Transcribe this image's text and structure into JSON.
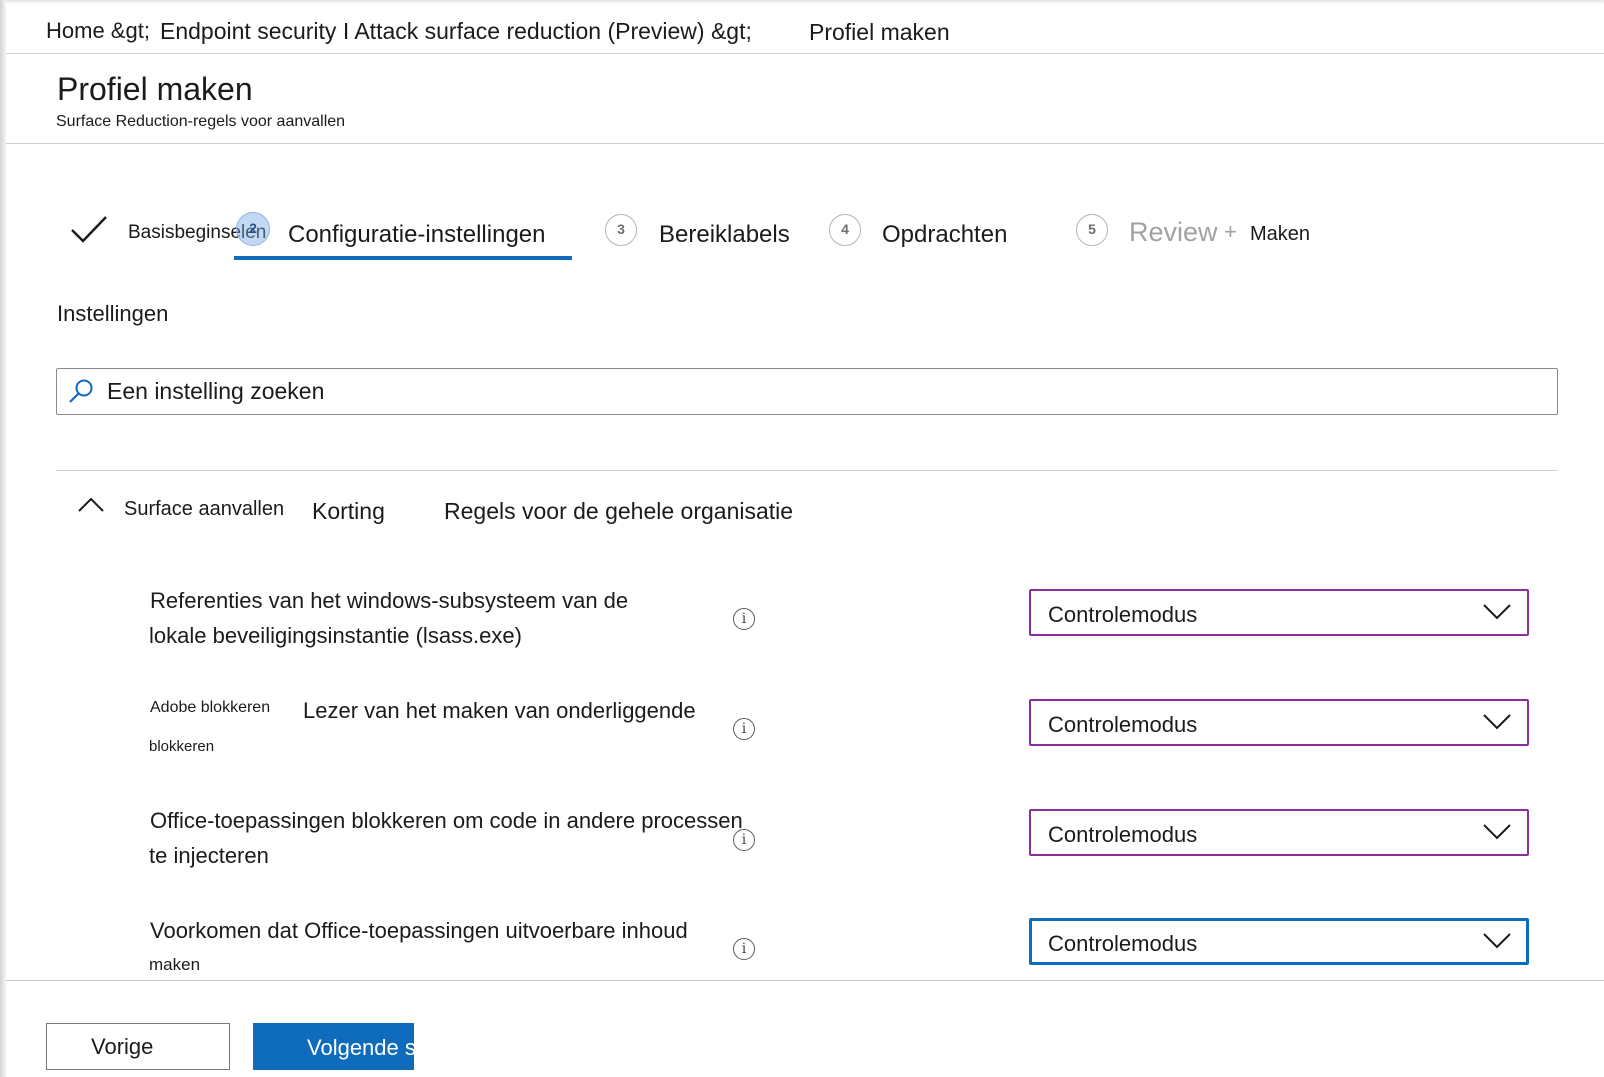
{
  "breadcrumb": {
    "home": "Home &gt;",
    "section": "Endpoint security I Attack surface reduction (Preview) &gt;",
    "current": "Profiel maken"
  },
  "header": {
    "title": "Profiel maken",
    "subtitle": "Surface Reduction-regels voor aanvallen"
  },
  "steps": {
    "step1": {
      "label": "Basisbeginselen"
    },
    "step2": {
      "number": "2",
      "label": "Configuratie-instellingen"
    },
    "step3": {
      "number": "3",
      "label": "Bereiklabels"
    },
    "step4": {
      "number": "4",
      "label": "Opdrachten"
    },
    "step5": {
      "number": "5",
      "label_a": "Review",
      "label_plus": "+",
      "label_b": "Maken"
    }
  },
  "settings": {
    "heading": "Instellingen",
    "search_placeholder": "Een instelling zoeken"
  },
  "group": {
    "part1": "Surface aanvallen",
    "part2": "Korting",
    "part3": "Regels voor de gehele organisatie"
  },
  "rules": [
    {
      "line1": "Referenties van het windows-subsysteem van de",
      "line2": "lokale beveiligingsinstantie (lsass.exe)",
      "value": "Controlemodus"
    },
    {
      "line1_small": "Adobe blokkeren",
      "line1": "Lezer van het maken van onderliggende",
      "line2": "blokkeren",
      "value": "Controlemodus"
    },
    {
      "line1": "Office-toepassingen blokkeren om code in andere processen",
      "line2": "te injecteren",
      "value": "Controlemodus"
    },
    {
      "line1": "Voorkomen dat Office-toepassingen uitvoerbare inhoud",
      "line2": "maken",
      "value": "Controlemodus"
    }
  ],
  "footer": {
    "previous": "Vorige",
    "next": "Volgende s"
  },
  "colors": {
    "accent": "#0f6cbd",
    "dropdown_border": "#8b2fa0"
  }
}
